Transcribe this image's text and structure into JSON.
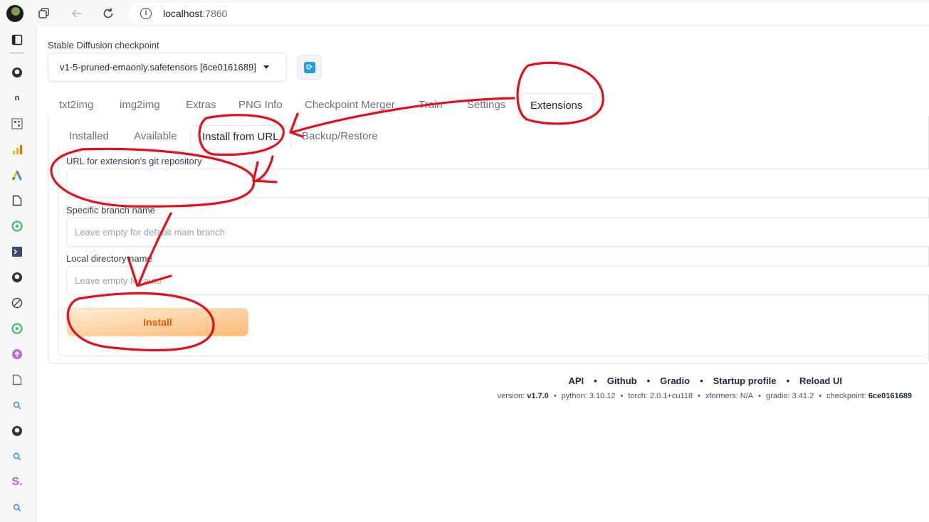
{
  "browser": {
    "url_host": "localhost",
    "url_port": ":7860"
  },
  "sidebar_icons": [
    "tabs-icon",
    "github-icon",
    "notion-icon",
    "qr-icon",
    "analytics-icon",
    "ads-icon",
    "document-icon",
    "chatgpt-icon",
    "terminal-icon",
    "github-icon",
    "compass-icon",
    "chatgpt-icon",
    "upload-icon",
    "document-icon",
    "search-icon",
    "github-icon",
    "search-icon",
    "s-icon",
    "search-icon"
  ],
  "checkpoint": {
    "label": "Stable Diffusion checkpoint",
    "value": "v1-5-pruned-emaonly.safetensors [6ce0161689]"
  },
  "tabs": [
    "txt2img",
    "img2img",
    "Extras",
    "PNG Info",
    "Checkpoint Merger",
    "Train",
    "Settings",
    "Extensions"
  ],
  "subtabs": [
    "Installed",
    "Available",
    "Install from URL",
    "Backup/Restore"
  ],
  "form": {
    "url_label": "URL for extension's git repository",
    "url_value": "",
    "branch_label": "Specific branch name",
    "branch_placeholder": "Leave empty for default main branch",
    "dir_label": "Local directory name",
    "dir_placeholder": "Leave empty for auto",
    "install_label": "Install"
  },
  "footer": {
    "links": [
      "API",
      "Github",
      "Gradio",
      "Startup profile",
      "Reload UI"
    ],
    "version_prefix": "version:",
    "version": "v1.7.0",
    "python": "python: 3.10.12",
    "torch": "torch: 2.0.1+cu118",
    "xformers": "xformers: N/A",
    "gradio": "gradio: 3.41.2",
    "checkpoint_prefix": "checkpoint:",
    "checkpoint": "6ce0161689"
  },
  "colors": {
    "accent_orange": "#ea580c",
    "annotation_red": "#e3101b",
    "refresh_blue": "#1e9de8"
  }
}
